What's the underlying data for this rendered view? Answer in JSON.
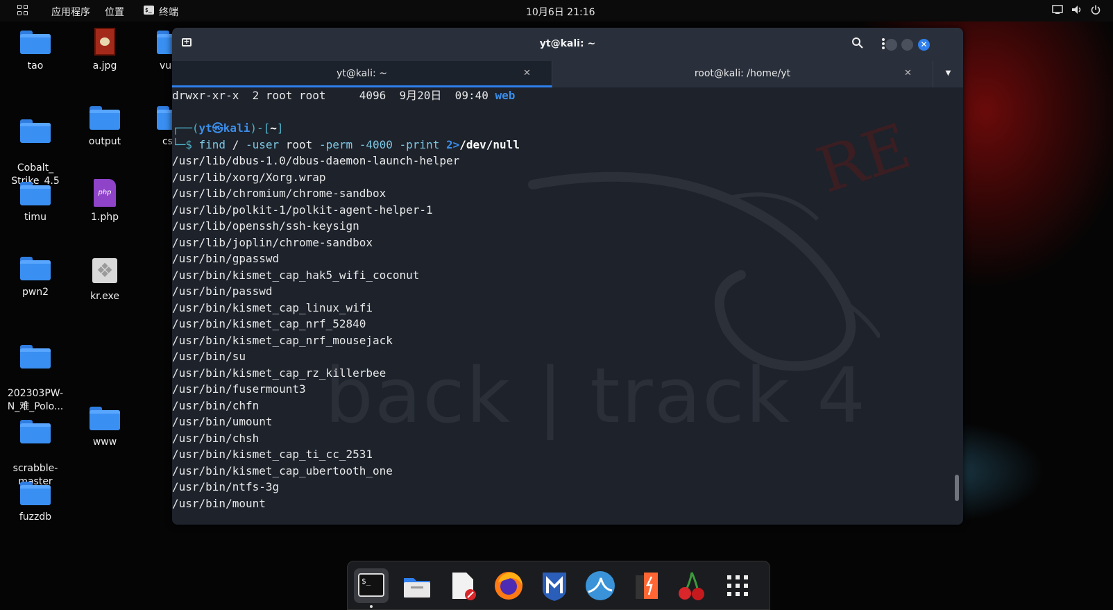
{
  "topbar": {
    "apps_label": "应用程序",
    "places_label": "位置",
    "terminal_label": "终端",
    "clock": "10月6日  21:16"
  },
  "desktop_icons": [
    {
      "label": "tao",
      "kind": "folder"
    },
    {
      "label": "a.jpg",
      "kind": "image"
    },
    {
      "label": "vul",
      "kind": "folder"
    },
    {
      "label": "Cobalt_\nStrike_4.5",
      "kind": "folder"
    },
    {
      "label": "output",
      "kind": "folder"
    },
    {
      "label": "cs",
      "kind": "folder"
    },
    {
      "label": "timu",
      "kind": "folder"
    },
    {
      "label": "1.php",
      "kind": "php"
    },
    {
      "label": "pwn2",
      "kind": "folder"
    },
    {
      "label": "kr.exe",
      "kind": "exe"
    },
    {
      "label": "202303PW-\nN_难_Polo...",
      "kind": "folder"
    },
    {
      "label": "scrabble-\nmaster",
      "kind": "folder"
    },
    {
      "label": "www",
      "kind": "folder"
    },
    {
      "label": "fuzzdb",
      "kind": "folder"
    }
  ],
  "terminal": {
    "window_title": "yt@kali: ~",
    "tabs": [
      {
        "label": "yt@kali: ~",
        "active": true
      },
      {
        "label": "root@kali: /home/yt",
        "active": false
      }
    ],
    "listing_line": {
      "perms": "drwxr-xr-x  2 root root     4096  9月20日  09:40 ",
      "name": "web"
    },
    "prompt": {
      "open": "┌──(",
      "user": "yt㉿kali",
      "close": ")-[",
      "dir": "~",
      "end": "]",
      "dollar": "└─$ "
    },
    "command": {
      "cmd": "find",
      "arg1": " / ",
      "opt1": "-user",
      "arg2": " root ",
      "opt2": "-perm",
      "opt3": " -4000",
      "opt4": " -print",
      "redir": " 2>",
      "target": "/dev/null"
    },
    "output": [
      "/usr/lib/dbus-1.0/dbus-daemon-launch-helper",
      "/usr/lib/xorg/Xorg.wrap",
      "/usr/lib/chromium/chrome-sandbox",
      "/usr/lib/polkit-1/polkit-agent-helper-1",
      "/usr/lib/openssh/ssh-keysign",
      "/usr/lib/joplin/chrome-sandbox",
      "/usr/bin/gpasswd",
      "/usr/bin/kismet_cap_hak5_wifi_coconut",
      "/usr/bin/passwd",
      "/usr/bin/kismet_cap_linux_wifi",
      "/usr/bin/kismet_cap_nrf_52840",
      "/usr/bin/kismet_cap_nrf_mousejack",
      "/usr/bin/su",
      "/usr/bin/kismet_cap_rz_killerbee",
      "/usr/bin/fusermount3",
      "/usr/bin/chfn",
      "/usr/bin/umount",
      "/usr/bin/chsh",
      "/usr/bin/kismet_cap_ti_cc_2531",
      "/usr/bin/kismet_cap_ubertooth_one",
      "/usr/bin/ntfs-3g",
      "/usr/bin/mount"
    ],
    "watermark": "back | track 4",
    "watermark2": "RE"
  },
  "dock": {
    "apps": [
      "terminal-icon",
      "files-icon",
      "text-editor-icon",
      "firefox-icon",
      "metasploit-icon",
      "wireshark-icon",
      "burpsuite-icon",
      "cherrytree-icon",
      "app-grid-icon"
    ]
  },
  "colors": {
    "accent": "#2f80ed",
    "prompt_blue": "#3b8eea",
    "terminal_bg": "#1d222b"
  }
}
